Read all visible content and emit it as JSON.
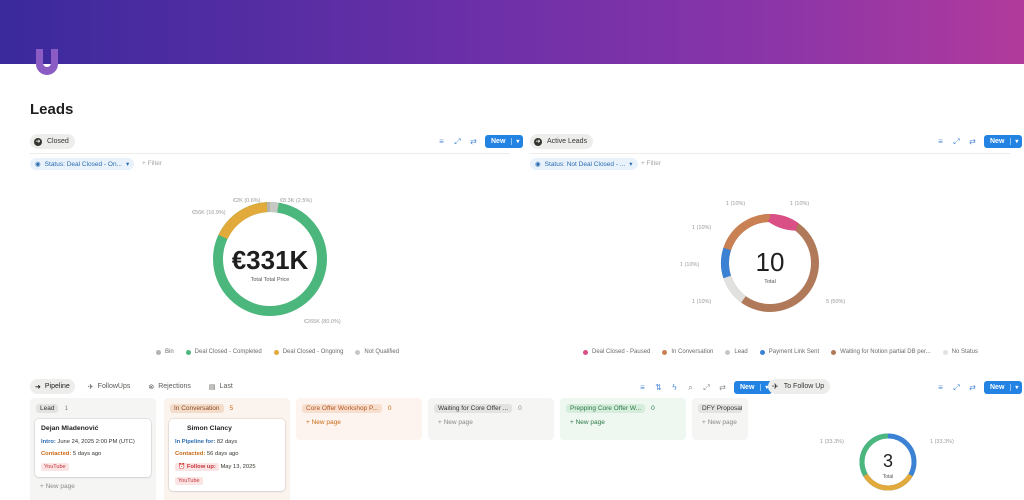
{
  "page": {
    "title": "Leads"
  },
  "closed_view": {
    "tab_label": "Closed",
    "new_label": "New",
    "filter_label": "Status: Deal Closed - On...",
    "add_filter": "+ Filter",
    "center_value": "€331K",
    "center_sub": "Total Total Price",
    "slice_labels": [
      "€2K (0.6%)",
      "€8.3K (2.5%)",
      "€56K (16.9%)",
      "€265K (80.0%)"
    ],
    "legend": [
      {
        "label": "Bin",
        "color": "#b4b4b0"
      },
      {
        "label": "Deal Closed - Completed",
        "color": "#4cb77d"
      },
      {
        "label": "Deal Closed - Ongoing",
        "color": "#e2a93b"
      },
      {
        "label": "Not Qualified",
        "color": "#c7c7c4"
      }
    ]
  },
  "active_view": {
    "tab_label": "Active Leads",
    "new_label": "New",
    "filter_label": "Status: Not Deal Closed - ...",
    "add_filter": "+ Filter",
    "center_value": "10",
    "center_sub": "Total",
    "slice_labels": [
      "1 (10%)",
      "1 (10%)",
      "1 (10%)",
      "1 (10%)",
      "1 (10%)",
      "5 (50%)"
    ],
    "legend": [
      {
        "label": "Deal Closed - Paused",
        "color": "#d94f86"
      },
      {
        "label": "In Conversation",
        "color": "#c98052"
      },
      {
        "label": "Lead",
        "color": "#c7c7c4"
      },
      {
        "label": "Payment Link Sent",
        "color": "#3b82d4"
      },
      {
        "label": "Waiting for Notion partial DB per...",
        "color": "#b07a5a"
      },
      {
        "label": "No Status",
        "color": "#e1e1df"
      }
    ]
  },
  "pipeline": {
    "tabs": [
      "Pipeline",
      "FollowUps",
      "Rejections",
      "Last"
    ],
    "new_label": "New",
    "new_page": "+ New page",
    "columns": [
      {
        "label": "Lead",
        "count": "1",
        "bg": "#f5f5f4",
        "pill": "#e3e3e1",
        "color": "#37352f"
      },
      {
        "label": "In Conversation",
        "count": "5",
        "bg": "#fbf3ee",
        "pill": "#f4dccb",
        "color": "#8a4b1f"
      },
      {
        "label": "Core Offer Workshop P...",
        "count": "0",
        "bg": "#fdf4ef",
        "pill": "#f7dfcf",
        "color": "#b5541b"
      },
      {
        "label": "Waiting for Core Offer ...",
        "count": "0",
        "bg": "#f5f5f4",
        "pill": "#e3e3e1",
        "color": "#37352f"
      },
      {
        "label": "Prepping Core Offer W...",
        "count": "0",
        "bg": "#eff7f1",
        "pill": "#d6ecdc",
        "color": "#2a7a46"
      },
      {
        "label": "DFY Proposal Se",
        "count": "",
        "bg": "#f5f5f4",
        "pill": "#e3e3e1",
        "color": "#37352f"
      }
    ],
    "card1": {
      "name": "Dejan Mladenović",
      "intro_k": "Intro:",
      "intro_v": "June 24, 2025 2:00 PM (UTC)",
      "contacted_k": "Contacted:",
      "contacted_v": "5 days ago",
      "tag": "YouTube"
    },
    "card2": {
      "name": "Simon Clancy",
      "pipe_k": "In Pipeline for:",
      "pipe_v": "82 days",
      "contacted_k": "Contacted:",
      "contacted_v": "56 days ago",
      "follow_k": "Follow up:",
      "follow_v": "May 13, 2025",
      "tag": "YouTube"
    }
  },
  "follow_up_view": {
    "tab_label": "To Follow Up",
    "new_label": "New",
    "center_value": "3",
    "center_sub": "Total",
    "slice_labels": [
      "1 (33.3%)",
      "1 (33.3%)"
    ]
  }
}
